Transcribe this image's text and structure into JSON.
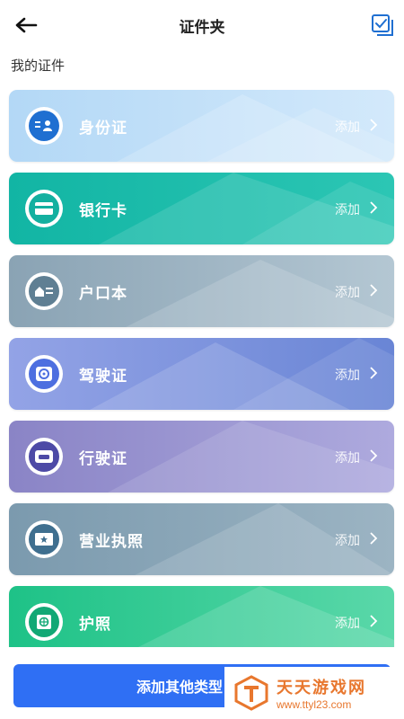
{
  "header": {
    "title": "证件夹"
  },
  "section": {
    "label": "我的证件"
  },
  "cards": [
    {
      "name": "身份证",
      "action": "添加",
      "icon": "id-card-icon",
      "color_from": "#b9dcf7",
      "color_to": "#d7ebfb",
      "icon_color": "#1f6fd1"
    },
    {
      "name": "银行卡",
      "action": "添加",
      "icon": "bank-card-icon",
      "color_from": "#14b9a8",
      "color_to": "#2ec9b7",
      "icon_color": "#13b0a0"
    },
    {
      "name": "户口本",
      "action": "添加",
      "icon": "household-icon",
      "color_from": "#8ea6b6",
      "color_to": "#b2c5d1",
      "icon_color": "#5f7f93"
    },
    {
      "name": "驾驶证",
      "action": "添加",
      "icon": "steering-wheel-icon",
      "color_from": "#8fa1e6",
      "color_to": "#6b86d6",
      "icon_color": "#4d6fe0"
    },
    {
      "name": "行驶证",
      "action": "添加",
      "icon": "car-icon",
      "color_from": "#8c87c8",
      "color_to": "#a9a6dc",
      "icon_color": "#4d4aa6"
    },
    {
      "name": "营业执照",
      "action": "添加",
      "icon": "license-icon",
      "color_from": "#7e9db0",
      "color_to": "#9db6c5",
      "icon_color": "#3f6f8f"
    },
    {
      "name": "护照",
      "action": "添加",
      "icon": "passport-icon",
      "color_from": "#21c48a",
      "color_to": "#56d6a6",
      "icon_color": "#12a875"
    }
  ],
  "bottom": {
    "add_other_label": "添加其他类型"
  },
  "watermark": {
    "line1": "天天游戏网",
    "line2": "www.ttyl23.com"
  }
}
